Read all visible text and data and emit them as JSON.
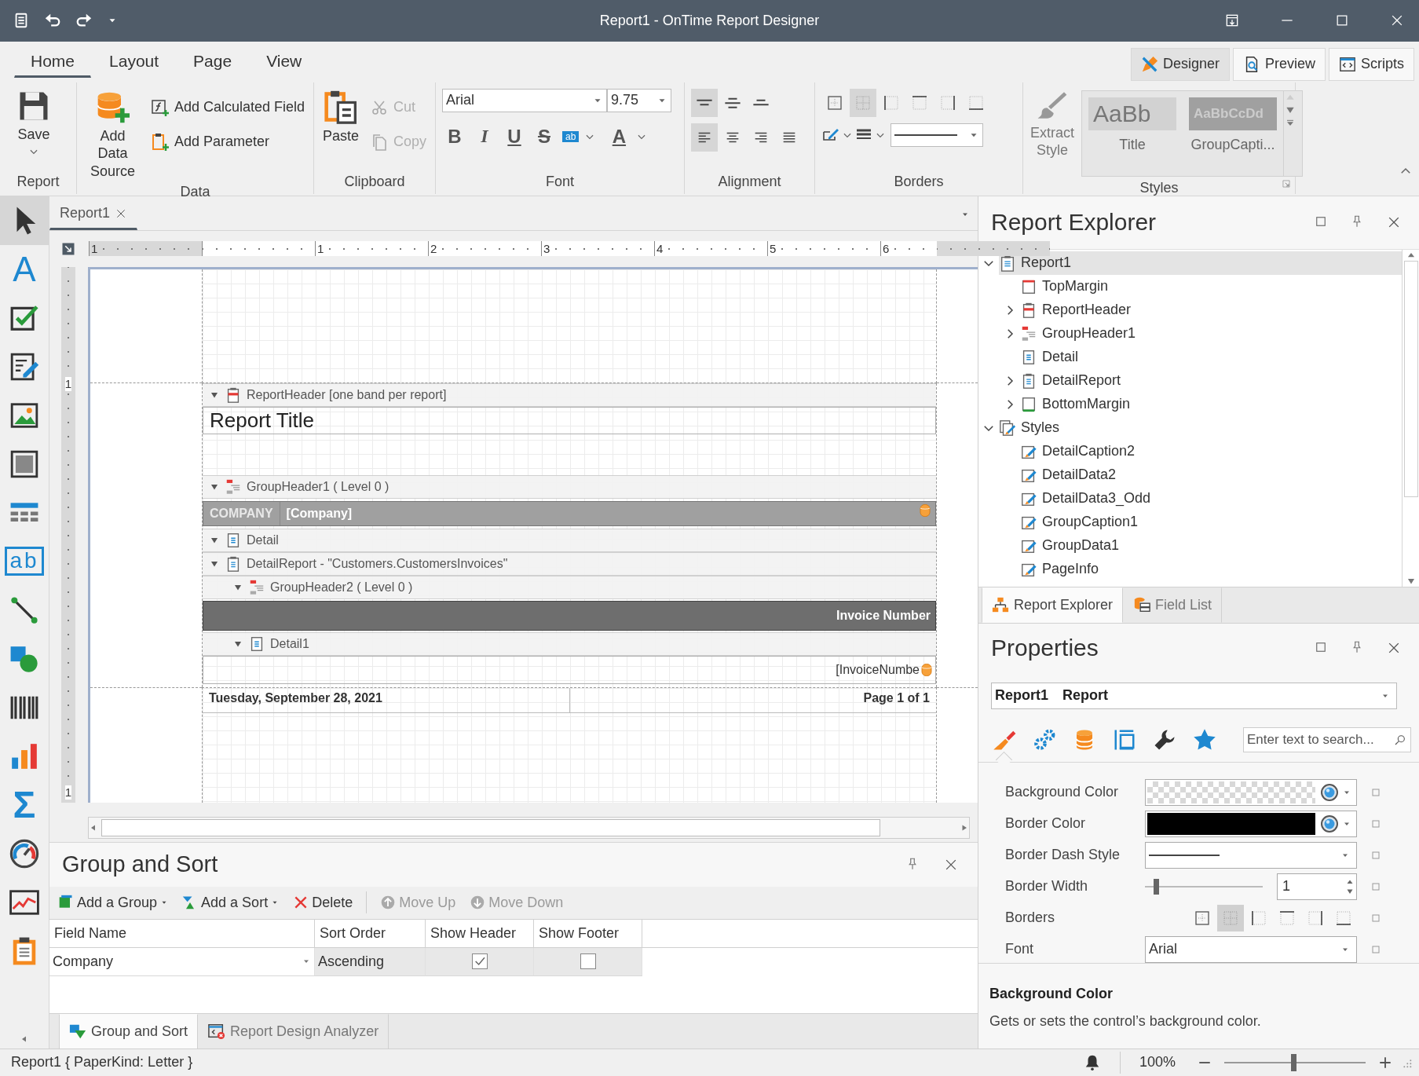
{
  "window": {
    "title": "Report1 - OnTime Report Designer"
  },
  "ribbon": {
    "tabs": [
      {
        "label": "Home",
        "selected": true
      },
      {
        "label": "Layout",
        "selected": false
      },
      {
        "label": "Page",
        "selected": false
      },
      {
        "label": "View",
        "selected": false
      }
    ],
    "modes": [
      {
        "kind": "designer",
        "label": "Designer",
        "selected": true
      },
      {
        "kind": "preview",
        "label": "Preview",
        "selected": false
      },
      {
        "kind": "scripts",
        "label": "Scripts",
        "selected": false
      }
    ],
    "report": {
      "label": "Report",
      "save": "Save"
    },
    "data": {
      "label": "Data",
      "buttons": [
        {
          "kind": "data_source",
          "label": "Add Data Source"
        },
        {
          "kind": "calculated_field",
          "label": "Add Calculated Field"
        },
        {
          "kind": "parameter",
          "label": "Add Parameter"
        }
      ]
    },
    "clipboard": {
      "label": "Clipboard",
      "buttons": [
        {
          "kind": "paste",
          "label": "Paste"
        },
        {
          "kind": "cut",
          "label": "Cut",
          "disabled": true
        },
        {
          "kind": "copy",
          "label": "Copy",
          "disabled": true
        }
      ]
    },
    "font": {
      "label": "Font",
      "family": "Arial",
      "size": "9.75",
      "styles": [
        {
          "kind": "bold",
          "label": "B"
        },
        {
          "kind": "italic",
          "label": "I"
        },
        {
          "kind": "underline",
          "label": "U"
        },
        {
          "kind": "strike",
          "label": "S"
        }
      ],
      "highlight": "ab",
      "color_glyph": "A"
    },
    "alignment": {
      "label": "Alignment",
      "vertical": [
        {
          "kind": "top",
          "selected": true
        },
        {
          "kind": "middle",
          "selected": false
        },
        {
          "kind": "bottom",
          "selected": false
        }
      ],
      "horizontal": [
        {
          "kind": "left",
          "selected": true
        },
        {
          "kind": "center",
          "selected": false
        },
        {
          "kind": "right",
          "selected": false
        },
        {
          "kind": "justify",
          "selected": false
        }
      ]
    },
    "borders": {
      "label": "Borders",
      "sides": [
        {
          "kind": "none",
          "selected": false
        },
        {
          "kind": "all",
          "selected": true
        },
        {
          "kind": "left",
          "selected": false
        },
        {
          "kind": "top",
          "selected": false
        },
        {
          "kind": "right",
          "selected": false
        },
        {
          "kind": "bottom",
          "selected": false
        }
      ]
    },
    "styles": {
      "label": "Styles",
      "extract": "Extract Style",
      "gallery": [
        {
          "kind": "title",
          "preview": "AaBb",
          "name": "Title"
        },
        {
          "kind": "caption",
          "preview": "AaBbCcDd",
          "name": "GroupCapti..."
        }
      ]
    }
  },
  "toolbox": [
    {
      "kind": "pointer",
      "selected": true
    },
    {
      "kind": "label",
      "glyph": "A",
      "selected": false
    },
    {
      "kind": "checkbox",
      "selected": false
    },
    {
      "kind": "rich_text",
      "selected": false
    },
    {
      "kind": "picture",
      "selected": false
    },
    {
      "kind": "panel",
      "selected": false
    },
    {
      "kind": "table",
      "selected": false
    },
    {
      "kind": "text_box",
      "glyph": "ab",
      "selected": false
    },
    {
      "kind": "line",
      "selected": false
    },
    {
      "kind": "shape",
      "selected": false
    },
    {
      "kind": "barcode",
      "selected": false
    },
    {
      "kind": "chart",
      "selected": false
    },
    {
      "kind": "summary",
      "glyph": "Σ",
      "selected": false
    },
    {
      "kind": "gauge",
      "selected": false
    },
    {
      "kind": "sparkline",
      "selected": false
    },
    {
      "kind": "page_info",
      "selected": false
    }
  ],
  "designer": {
    "tabs": [
      {
        "label": "Report1",
        "selected": true
      }
    ],
    "ruler": {
      "horizontal": [
        "1",
        "1",
        "2",
        "3",
        "4",
        "5",
        "6"
      ],
      "vertical": [
        "1",
        "1"
      ]
    },
    "bands": [
      {
        "kind": "report_header",
        "label": "ReportHeader [one band per report]",
        "expanded": true,
        "controls": [
          {
            "kind": "title",
            "text": "Report Title"
          }
        ]
      },
      {
        "kind": "group_header",
        "label": "GroupHeader1 ( Level 0 )",
        "expanded": true,
        "controls": [
          {
            "kind": "caption_row",
            "cells": [
              "COMPANY",
              "[Company]"
            ]
          }
        ]
      },
      {
        "kind": "detail",
        "label": "Detail",
        "expanded": true
      },
      {
        "kind": "detail_report",
        "label": "DetailReport - \"Customers.CustomersInvoices\"",
        "expanded": true,
        "children": [
          {
            "kind": "group_header",
            "label": "GroupHeader2 ( Level 0 )",
            "expanded": true,
            "controls": [
              {
                "kind": "header_row",
                "text": "Invoice Number"
              }
            ]
          },
          {
            "kind": "detail",
            "label": "Detail1",
            "expanded": true,
            "controls": [
              {
                "kind": "data_row",
                "text": "[InvoiceNumbe"
              }
            ]
          }
        ]
      }
    ],
    "footer": {
      "left": "Tuesday, September 28, 2021",
      "right": "Page 1 of 1"
    }
  },
  "group_sort": {
    "title": "Group and Sort",
    "toolbar": [
      {
        "kind": "add_group",
        "label": "Add a Group",
        "menu": true,
        "disabled": false
      },
      {
        "kind": "add_sort",
        "label": "Add a Sort",
        "menu": true,
        "disabled": false
      },
      {
        "kind": "delete",
        "label": "Delete",
        "menu": false,
        "disabled": false
      },
      {
        "kind": "move_up",
        "label": "Move Up",
        "menu": false,
        "disabled": true
      },
      {
        "kind": "move_down",
        "label": "Move Down",
        "menu": false,
        "disabled": true
      }
    ],
    "columns": [
      "Field Name",
      "Sort Order",
      "Show Header",
      "Show Footer"
    ],
    "rows": [
      {
        "field_name": "Company",
        "sort_order": "Ascending",
        "show_header": true,
        "show_footer": false
      }
    ],
    "tabs": [
      {
        "kind": "group_sort",
        "label": "Group and Sort",
        "selected": true
      },
      {
        "kind": "analyzer",
        "label": "Report Design Analyzer",
        "selected": false
      }
    ]
  },
  "report_explorer": {
    "title": "Report Explorer",
    "tree": [
      {
        "kind": "report",
        "label": "Report1",
        "expanded": true,
        "selected": true,
        "children": [
          {
            "kind": "top_margin",
            "label": "TopMargin",
            "selected": false
          },
          {
            "kind": "report_header",
            "label": "ReportHeader",
            "expanded": false,
            "selected": false
          },
          {
            "kind": "group_header",
            "label": "GroupHeader1",
            "expanded": false,
            "selected": false
          },
          {
            "kind": "detail",
            "label": "Detail",
            "selected": false
          },
          {
            "kind": "detail_report",
            "label": "DetailReport",
            "expanded": false,
            "selected": false
          },
          {
            "kind": "bottom_margin",
            "label": "BottomMargin",
            "expanded": false,
            "selected": false
          }
        ]
      },
      {
        "kind": "styles",
        "label": "Styles",
        "expanded": true,
        "selected": false,
        "children": [
          {
            "kind": "style",
            "label": "DetailCaption2",
            "selected": false
          },
          {
            "kind": "style",
            "label": "DetailData2",
            "selected": false
          },
          {
            "kind": "style",
            "label": "DetailData3_Odd",
            "selected": false
          },
          {
            "kind": "style",
            "label": "GroupCaption1",
            "selected": false
          },
          {
            "kind": "style",
            "label": "GroupData1",
            "selected": false
          },
          {
            "kind": "style",
            "label": "PageInfo",
            "selected": false
          }
        ]
      }
    ],
    "tabs": [
      {
        "kind": "explorer",
        "label": "Report Explorer",
        "selected": true
      },
      {
        "kind": "fields",
        "label": "Field List",
        "selected": false
      }
    ]
  },
  "properties": {
    "title": "Properties",
    "object": {
      "name": "Report1",
      "type": "Report"
    },
    "tabs": [
      {
        "kind": "appearance",
        "selected": true
      },
      {
        "kind": "behavior",
        "selected": false
      },
      {
        "kind": "data",
        "selected": false
      },
      {
        "kind": "layout",
        "selected": false
      },
      {
        "kind": "tools",
        "selected": false
      },
      {
        "kind": "favorites",
        "selected": false
      }
    ],
    "search": {
      "placeholder": "Enter text to search..."
    },
    "rows": [
      {
        "kind": "color",
        "label": "Background Color",
        "transparent": true
      },
      {
        "kind": "color",
        "label": "Border Color",
        "transparent": false,
        "color": "#000000"
      },
      {
        "kind": "dash",
        "label": "Border Dash Style"
      },
      {
        "kind": "number",
        "label": "Border Width",
        "level": 0.09,
        "value": "1"
      },
      {
        "kind": "borders",
        "label": "Borders",
        "sides": [
          {
            "kind": "none",
            "selected": false
          },
          {
            "kind": "all",
            "selected": true
          },
          {
            "kind": "left",
            "selected": false
          },
          {
            "kind": "top",
            "selected": false
          },
          {
            "kind": "right",
            "selected": false
          },
          {
            "kind": "bottom",
            "selected": false
          }
        ]
      },
      {
        "kind": "dropdown",
        "label": "Font",
        "value": "Arial"
      }
    ],
    "description": {
      "title": "Background Color",
      "text": "Gets or sets the control’s background color."
    }
  },
  "status_bar": {
    "text": "Report1 { PaperKind: Letter }",
    "zoom": "100%",
    "zoom_slider": {
      "level": 0.49
    }
  }
}
